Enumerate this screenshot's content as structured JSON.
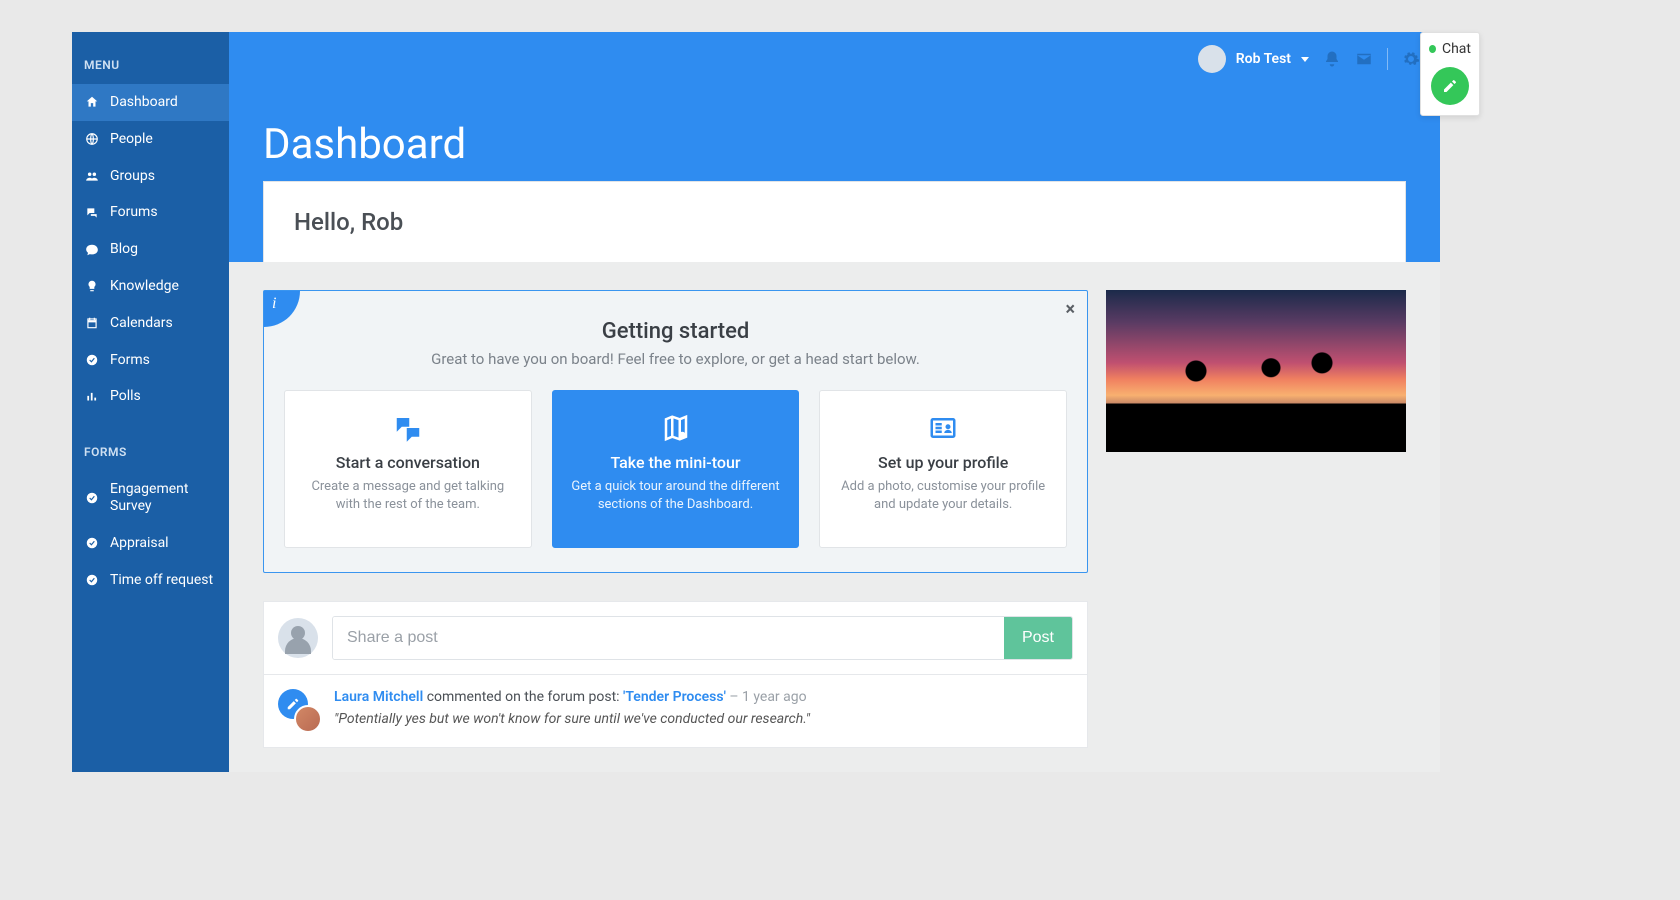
{
  "sidebar": {
    "menu_label": "MENU",
    "forms_label": "FORMS",
    "items": [
      {
        "label": "Dashboard",
        "icon": "home"
      },
      {
        "label": "People",
        "icon": "globe"
      },
      {
        "label": "Groups",
        "icon": "users"
      },
      {
        "label": "Forums",
        "icon": "forum"
      },
      {
        "label": "Blog",
        "icon": "chat"
      },
      {
        "label": "Knowledge",
        "icon": "bulb"
      },
      {
        "label": "Calendars",
        "icon": "calendar"
      },
      {
        "label": "Forms",
        "icon": "check"
      },
      {
        "label": "Polls",
        "icon": "bars"
      }
    ],
    "form_items": [
      {
        "label": "Engagement Survey"
      },
      {
        "label": "Appraisal"
      },
      {
        "label": "Time off request"
      }
    ]
  },
  "topbar": {
    "user_name": "Rob Test"
  },
  "hero": {
    "title": "Dashboard",
    "greeting": "Hello, Rob"
  },
  "getting_started": {
    "title": "Getting started",
    "subtitle": "Great to have you on board! Feel free to explore, or get a head start below.",
    "cards": [
      {
        "title": "Start a conversation",
        "desc": "Create a message and get talking with the rest of the team."
      },
      {
        "title": "Take the mini-tour",
        "desc": "Get a quick tour around the different sections of the Dashboard."
      },
      {
        "title": "Set up your profile",
        "desc": "Add a photo, customise your profile and update your details."
      }
    ]
  },
  "share": {
    "placeholder": "Share a post",
    "button": "Post"
  },
  "feed": {
    "item": {
      "author": "Laura Mitchell",
      "action_text": " commented on the forum post: ",
      "post_title": "'Tender Process'",
      "separator": " – ",
      "ago": "1 year ago",
      "quote": "\"Potentially yes but we won't know for sure until we've conducted our research.\""
    }
  },
  "chat": {
    "label": "Chat"
  }
}
